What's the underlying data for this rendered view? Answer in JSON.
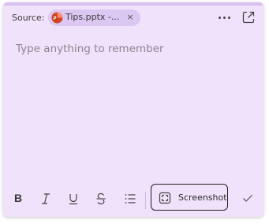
{
  "header": {
    "source_label": "Source:",
    "source_chip": {
      "icon": "powerpoint-icon",
      "text": "Tips.pptx -...",
      "close_glyph": "×"
    },
    "more_icon": "more-options-icon",
    "open_icon": "open-in-new-window-icon"
  },
  "editor": {
    "placeholder": "Type anything to remember"
  },
  "toolbar": {
    "bold_glyph": "B",
    "screenshot_label": "Screenshot",
    "icons": [
      "bold-icon",
      "italic-icon",
      "underline-icon",
      "strikethrough-icon",
      "bulleted-list-icon",
      "screenshot-icon",
      "checkmark-icon"
    ]
  },
  "colors": {
    "background": "#f1e2fc",
    "chip": "#dcc7f2",
    "powerpoint": "#d24726"
  }
}
